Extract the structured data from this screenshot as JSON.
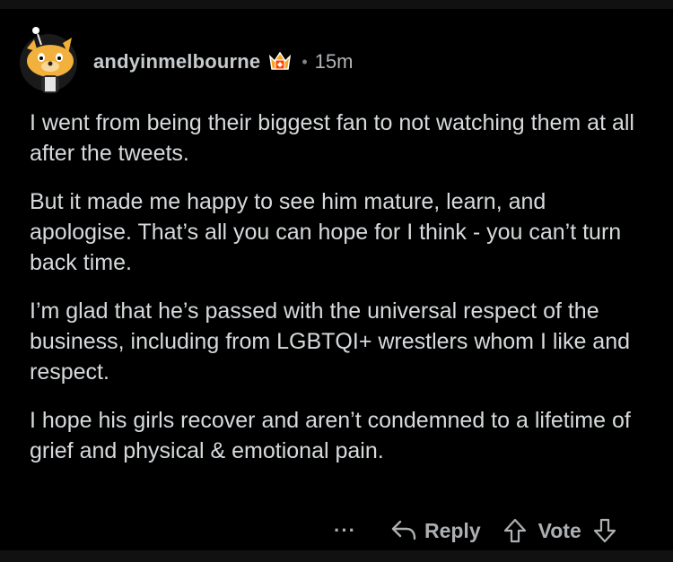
{
  "comment": {
    "username": "andyinmelbourne",
    "time": "15m",
    "paragraphs": [
      "I went from being their biggest fan to not watching them at all after the tweets.",
      "But it made me happy to see him mature, learn, and apologise. That’s all you can hope for I think - you can’t turn back time.",
      "I’m glad that he’s passed with the universal respect of the business, including from LGBTQI+ wrestlers whom I like and respect.",
      "I hope his girls recover and aren’t condemned to a lifetime of grief and physical & emotional pain."
    ]
  },
  "actions": {
    "more": "···",
    "reply": "Reply",
    "vote": "Vote"
  },
  "icons": {
    "avatar": "snoo-avatar",
    "flair": "achievement-crown-icon",
    "reply": "reply-arrow-icon",
    "upvote": "upvote-arrow-icon",
    "downvote": "downvote-arrow-icon"
  },
  "colors": {
    "background": "#000000",
    "text": "#d7dadc",
    "muted": "#adb0b2",
    "flair_orange": "#ff4500"
  }
}
